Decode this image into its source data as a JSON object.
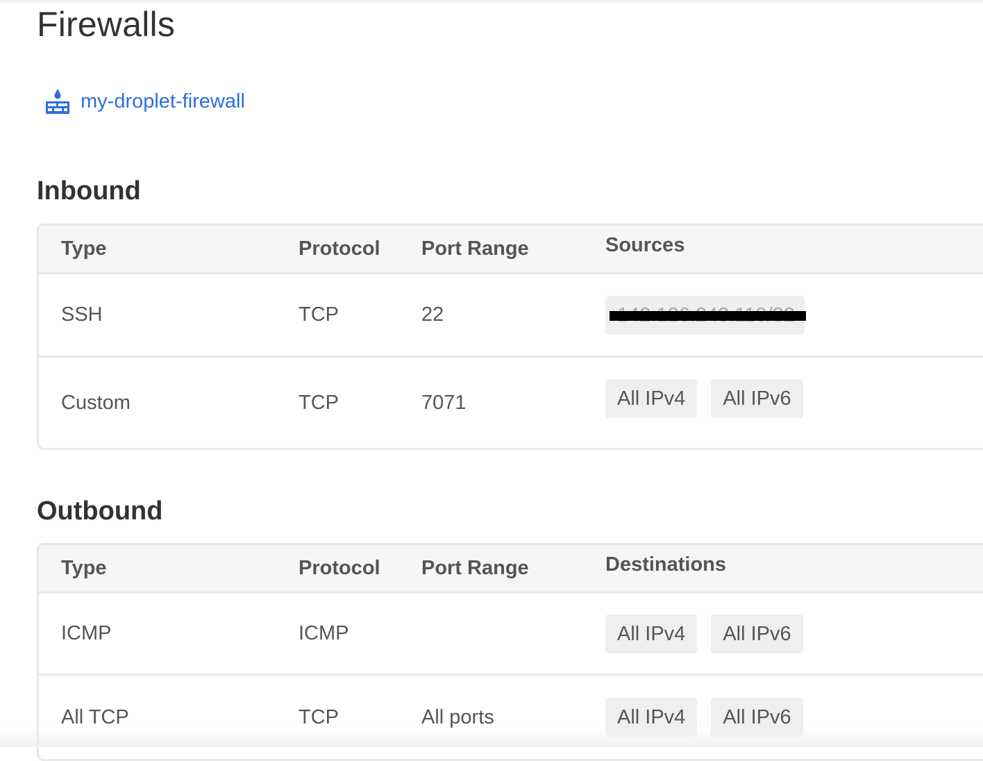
{
  "page": {
    "title": "Firewalls"
  },
  "firewall": {
    "name": "my-droplet-firewall",
    "icon": "firewall-icon",
    "accent_color": "#2f6fdb"
  },
  "inbound": {
    "title": "Inbound",
    "headers": {
      "type": "Type",
      "protocol": "Protocol",
      "port_range": "Port Range",
      "sources": "Sources"
    },
    "rules": [
      {
        "type": "SSH",
        "protocol": "TCP",
        "port_range": "22",
        "sources": [
          "142.126.243.110/32"
        ],
        "sources_redacted": true
      },
      {
        "type": "Custom",
        "protocol": "TCP",
        "port_range": "7071",
        "sources": [
          "All IPv4",
          "All IPv6"
        ]
      }
    ]
  },
  "outbound": {
    "title": "Outbound",
    "headers": {
      "type": "Type",
      "protocol": "Protocol",
      "port_range": "Port Range",
      "destinations": "Destinations"
    },
    "rules": [
      {
        "type": "ICMP",
        "protocol": "ICMP",
        "port_range": "",
        "destinations": [
          "All IPv4",
          "All IPv6"
        ]
      },
      {
        "type": "All TCP",
        "protocol": "TCP",
        "port_range": "All ports",
        "destinations": [
          "All IPv4",
          "All IPv6"
        ]
      }
    ]
  }
}
